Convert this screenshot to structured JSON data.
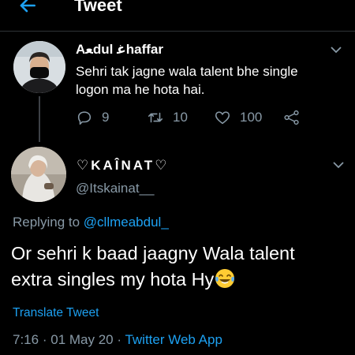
{
  "header": {
    "title": "Tweet",
    "back_icon": "arrow-left-icon"
  },
  "parent_tweet": {
    "author_name": "Aﻌdul ﻏhaffar",
    "body_lines": [
      "Sehri tak jagne wala talent bhe single",
      "logon ma he hota hai."
    ],
    "replies": "9",
    "retweets": "10",
    "likes": "100",
    "icons": [
      "reply-icon",
      "retweet-icon",
      "like-icon",
      "share-icon"
    ]
  },
  "main_tweet": {
    "author_name": "♡KAÎNAT♡",
    "handle": "@Itskainat__",
    "replying_prefix": "Replying to",
    "replying_mention": "@cllmeabdul_",
    "text_lines": [
      "Or sehri k baad jaagny Wala talent",
      "extra singles my hota Hy"
    ],
    "emoji": "laughing-tears-emoji",
    "translate_label": "Translate Tweet",
    "time": "7:16",
    "separator": "·",
    "date": "01 May 20",
    "source": "Twitter Web App"
  },
  "colors": {
    "background": "#000000",
    "text": "#ffffff",
    "secondary": "#8899a6",
    "accent": "#1da1f2",
    "divider": "#2f3336"
  }
}
